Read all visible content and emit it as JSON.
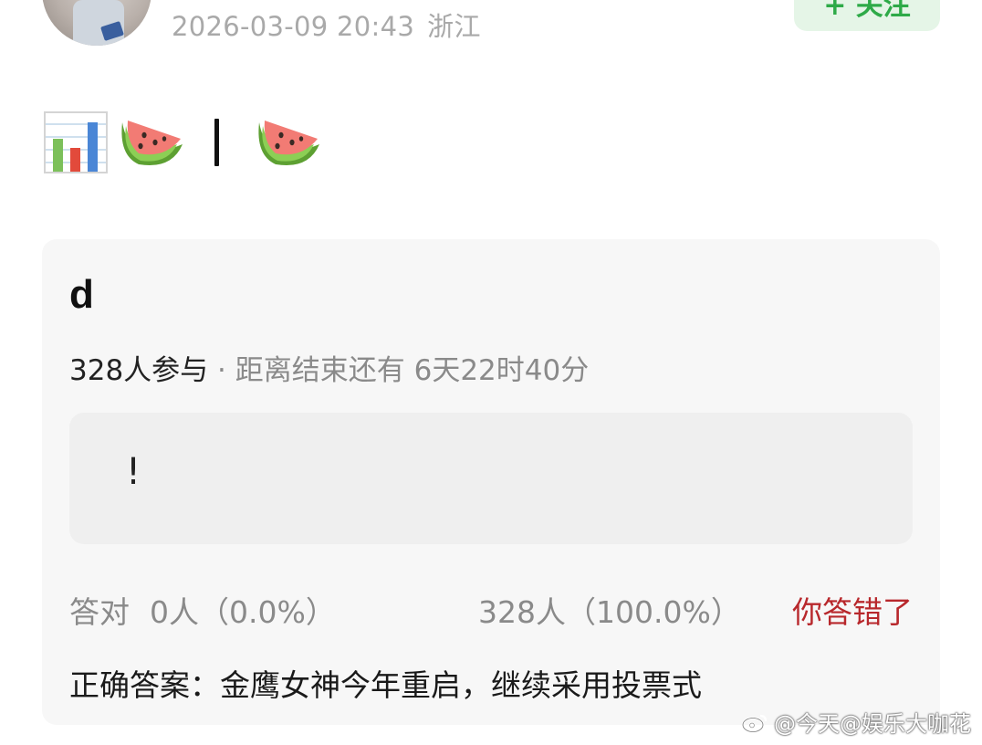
{
  "post": {
    "timestamp": "2026-03-09 20:43",
    "location": "浙江",
    "follow_label": "+ 关注",
    "icons": [
      "bar-chart-emoji",
      "watermelon-emoji",
      "watermelon-emoji"
    ]
  },
  "quiz": {
    "title": "d",
    "participants": "328人参与",
    "separator": "·",
    "remaining": "距离结束还有 6天22时40分",
    "option_text": "!",
    "correct_label": "答对",
    "correct_count": "0人（0.0%）",
    "other_count": "328人（100.0%）",
    "wrong_label": "你答错了",
    "answer": "正确答案：金鹰女神今年重启，继续采用投票式"
  },
  "watermark": {
    "text": "@今天@娱乐大咖花"
  },
  "colors": {
    "follow_green": "#2eaa48",
    "wrong_red": "#b8282c",
    "muted_gray": "#8a8a8a",
    "card_bg": "#f7f7f7"
  }
}
